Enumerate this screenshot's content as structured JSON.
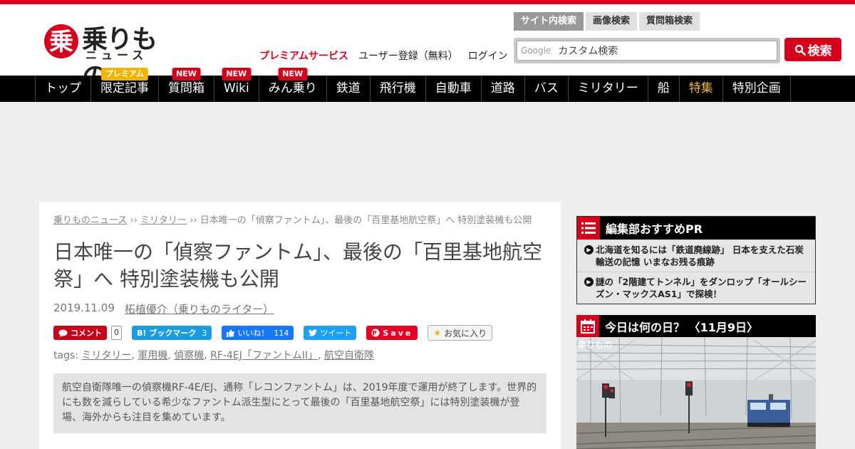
{
  "brand": {
    "logo_main": "乗りもの",
    "logo_sub": "ニュース",
    "accent_color": "#d5001c"
  },
  "header": {
    "links": {
      "premium": "プレミアムサービス",
      "register": "ユーザー登録（無料）",
      "login": "ログイン"
    },
    "search": {
      "tabs": [
        "サイト内検索",
        "画像検索",
        "質問箱検索"
      ],
      "google_label": "Google",
      "placeholder": "カスタム検索",
      "button_label": "検索"
    }
  },
  "nav": {
    "items": [
      {
        "label": "トップ"
      },
      {
        "label": "限定記事",
        "badge": "プレミアム"
      },
      {
        "label": "質問箱",
        "badge": "NEW"
      },
      {
        "label": "Wiki",
        "badge": "NEW"
      },
      {
        "label": "みん乗り",
        "badge": "NEW"
      },
      {
        "label": "鉄道"
      },
      {
        "label": "飛行機"
      },
      {
        "label": "自動車"
      },
      {
        "label": "道路"
      },
      {
        "label": "バス"
      },
      {
        "label": "ミリタリー"
      },
      {
        "label": "船"
      },
      {
        "label": "特集"
      },
      {
        "label": "特別企画"
      }
    ]
  },
  "article": {
    "breadcrumb": {
      "home": "乗りものニュース",
      "sep": "››",
      "category": "ミリタリー",
      "current": "日本唯一の「偵察ファントム」、最後の「百里基地航空祭」へ 特別塗装機も公開"
    },
    "title": "日本唯一の「偵察ファントム」、最後の「百里基地航空祭」へ 特別塗装機も公開",
    "date": "2019.11.09",
    "author": "柘植優介（乗りものライター）",
    "social": {
      "comment_label": "コメント",
      "comment_count": "0",
      "hatena_label": "ブックマーク",
      "hatena_count": "3",
      "fb_label": "いいね！",
      "fb_count": "114",
      "tweet_label": "ツイート",
      "pin_label": "Save",
      "fav_label": "お気に入り"
    },
    "tags_label": "tags:",
    "tags": [
      "ミリタリー",
      "軍用機",
      "偵察機",
      "RF-4EJ「ファントムII」",
      "航空自衛隊"
    ],
    "lead": "航空自衛隊唯一の偵察機RF-4E/EJ、通称「レコンファントム」は、2019年度で運用が終了します。世界的にも数を減らしている希少なファントム派生型にとって最後の「百里基地航空祭」には特別塗装機が登場、海外からも注目を集めています。"
  },
  "sidebar": {
    "recommend": {
      "title": "編集部おすすめPR",
      "items": [
        "北海道を知るには「鉄道廃線跡」 日本を支えた石炭輸送の記憶 いまなお残る痕跡",
        "謎の「2階建てトンネル」をダンロップ「オールシーズン・マックスAS1」で探検！"
      ]
    },
    "today": {
      "title": "今日は何の日？ 〈11月9日〉",
      "watermark": "乗りもの"
    }
  }
}
